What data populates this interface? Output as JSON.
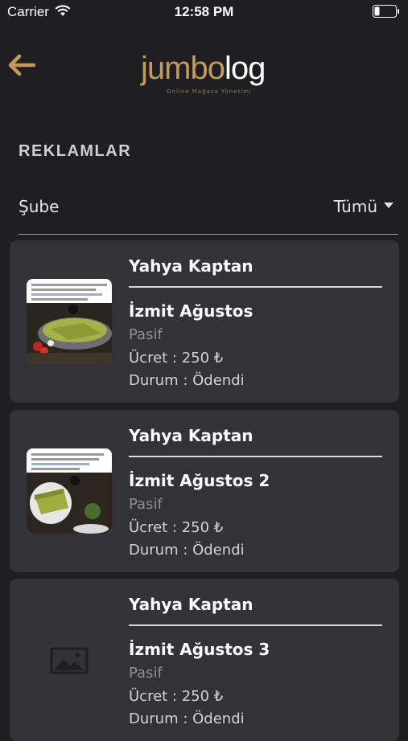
{
  "status_bar": {
    "carrier": "Carrier",
    "time": "12:58 PM",
    "icons": [
      "wifi-icon",
      "battery-icon"
    ]
  },
  "header": {
    "back_icon": "arrow-left-icon",
    "logo_text_a": "jumbo",
    "logo_text_b": "log",
    "logo_tagline": "Online Mağaza Yönetimi",
    "accent_color": "#c39a5b"
  },
  "section_title": "REKLAMLAR",
  "filter": {
    "label": "Şube",
    "selected": "Tümü"
  },
  "ads": [
    {
      "branch": "Yahya Kaptan",
      "name": "İzmit Ağustos",
      "status": "Pasif",
      "fee": "Ücret : 250 ₺",
      "payment": "Durum : Ödendi",
      "image": "pistachio-cake-photo"
    },
    {
      "branch": "Yahya Kaptan",
      "name": "İzmit Ağustos 2",
      "status": "Pasif",
      "fee": "Ücret : 250 ₺",
      "payment": "Durum : Ödendi",
      "image": "pistachio-cake-photo"
    },
    {
      "branch": "Yahya Kaptan",
      "name": "İzmit Ağustos 3",
      "status": "Pasif",
      "fee": "Ücret : 250 ₺",
      "payment": "Durum : Ödendi",
      "image": "image-placeholder-icon"
    }
  ]
}
